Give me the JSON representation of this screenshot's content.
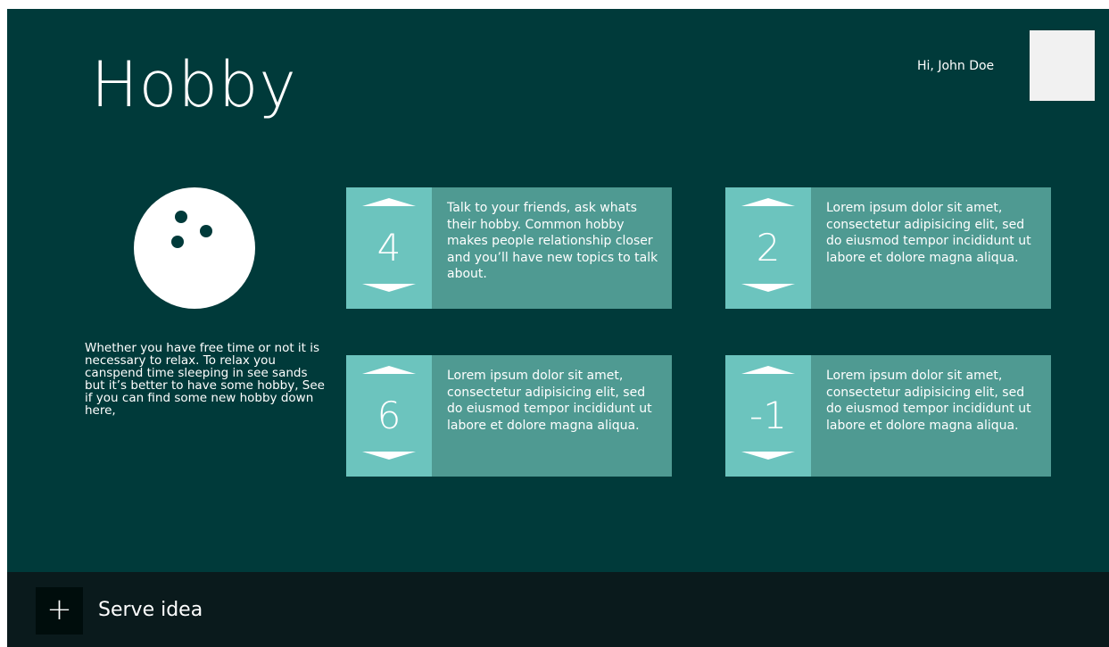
{
  "header": {
    "title": "Hobby",
    "greeting": "Hi, John Doe"
  },
  "intro": {
    "text": "Whether you have free time or not it is necessary to relax. To relax you canspend time sleeping in see sands but it’s better to have some hobby, See if you can find some new hobby down here,"
  },
  "cards": [
    {
      "count": "4",
      "text": "Talk to your friends, ask whats their hobby. Common hobby makes people relationship closer and you’ll have new topics to talk about."
    },
    {
      "count": "2",
      "text": "Lorem ipsum dolor sit amet, consectetur adipisicing elit, sed do eiusmod tempor incididunt ut labore et dolore magna aliqua."
    },
    {
      "count": "6",
      "text": "Lorem ipsum dolor sit amet, consectetur adipisicing elit, sed do eiusmod tempor incididunt ut labore et dolore magna aliqua."
    },
    {
      "count": "-1",
      "text": "Lorem ipsum dolor sit amet, consectetur adipisicing elit, sed do eiusmod tempor incididunt ut labore et dolore magna aliqua."
    }
  ],
  "bottom_bar": {
    "add_icon": "+",
    "add_label": "Serve idea"
  },
  "icons": {
    "ball": "bowling-ball-icon",
    "up": "arrow-up-icon",
    "down": "arrow-down-icon",
    "add": "plus-icon"
  },
  "colors": {
    "background": "#003a3a",
    "card": "#4f9a92",
    "counter": "#6cc4be",
    "bottom_bar": "#0a1a1c"
  }
}
